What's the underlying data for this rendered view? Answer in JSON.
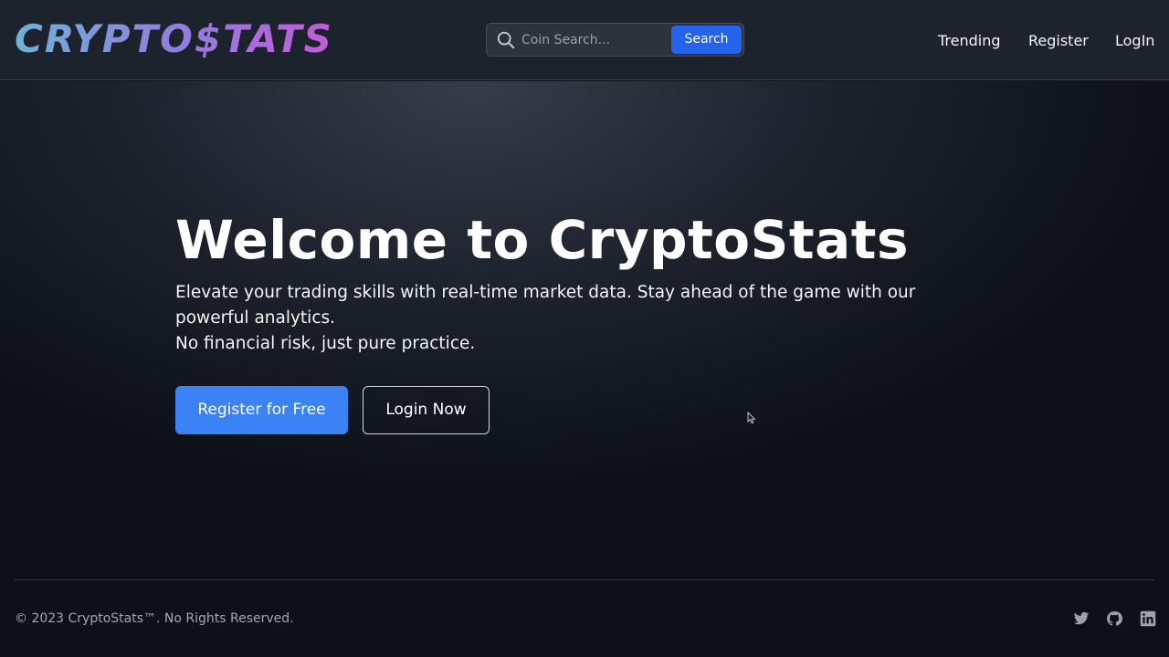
{
  "brand": {
    "logo_text": "CRYPTO$TATS"
  },
  "search": {
    "placeholder": "Coin Search...",
    "button_label": "Search",
    "icon": "search-icon"
  },
  "nav": {
    "items": [
      {
        "label": "Trending"
      },
      {
        "label": "Register"
      },
      {
        "label": "LogIn"
      }
    ]
  },
  "hero": {
    "title": "Welcome to CryptoStats",
    "line1": "Elevate your trading skills with real-time market data. Stay ahead of the game with our powerful analytics.",
    "line2": "No financial risk, just pure practice.",
    "primary_button": "Register for Free",
    "secondary_button": "Login Now"
  },
  "footer": {
    "copyright": "© 2023 CryptoStats™. No Rights Reserved.",
    "social": [
      "twitter-icon",
      "github-icon",
      "linkedin-icon"
    ]
  },
  "colors": {
    "accent": "#3b82f6",
    "search_button": "#2563eb",
    "navbar_bg": "#1d232d",
    "page_bg": "#0d1117"
  }
}
